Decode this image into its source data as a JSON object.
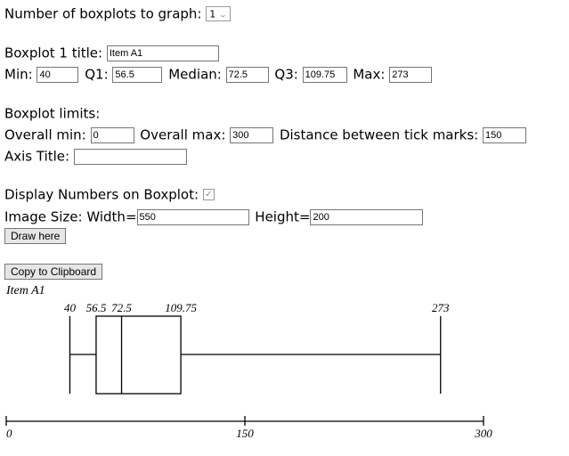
{
  "count": {
    "label": "Number of boxplots to graph:",
    "value": "1"
  },
  "boxplot": {
    "title_label": "Boxplot 1 title:",
    "title": "Item A1",
    "min_label": "Min:",
    "min": "40",
    "q1_label": "Q1:",
    "q1": "56.5",
    "median_label": "Median:",
    "median": "72.5",
    "q3_label": "Q3:",
    "q3": "109.75",
    "max_label": "Max:",
    "max": "273"
  },
  "limits": {
    "heading": "Boxplot limits:",
    "min_label": "Overall min:",
    "min": "0",
    "max_label": "Overall max:",
    "max": "300",
    "tick_label": "Distance between tick marks:",
    "tick": "150",
    "axis_title_label": "Axis Title:",
    "axis_title": ""
  },
  "display": {
    "label": "Display Numbers on Boxplot:",
    "checked": true
  },
  "size": {
    "label": "Image Size: Width=",
    "width": "550",
    "height_label": "Height=",
    "height": "200"
  },
  "buttons": {
    "draw": "Draw here",
    "copy": "Copy to Clipboard"
  },
  "chart_data": {
    "type": "boxplot",
    "title": "Item A1",
    "min": 40,
    "q1": 56.5,
    "median": 72.5,
    "q3": 109.75,
    "max": 273,
    "value_labels": [
      "40",
      "56.5",
      "72.5",
      "109.75",
      "273"
    ],
    "xlim": [
      0,
      300
    ],
    "ticks": [
      0,
      150,
      300
    ],
    "tick_labels": [
      "0",
      "150",
      "300"
    ]
  }
}
